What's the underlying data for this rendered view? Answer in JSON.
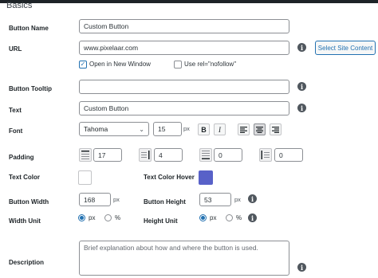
{
  "section": {
    "title": "Basics"
  },
  "labels": {
    "button_name": "Button Name",
    "url": "URL",
    "tooltip": "Button Tooltip",
    "text": "Text",
    "font": "Font",
    "padding": "Padding",
    "text_color": "Text Color",
    "text_color_hover": "Text Color Hover",
    "button_width": "Button Width",
    "button_height": "Button Height",
    "width_unit": "Width Unit",
    "height_unit": "Height Unit",
    "description": "Description"
  },
  "fields": {
    "button_name": "Custom Button",
    "url": "www.pixelaar.com",
    "tooltip": "",
    "text": "Custom Button",
    "font_family": "Tahoma",
    "font_size": "15",
    "font_size_unit": "px",
    "padding_top": "17",
    "padding_right": "4",
    "padding_bottom": "0",
    "padding_left": "0",
    "button_width": "168",
    "button_width_unit": "px",
    "button_height": "53",
    "button_height_unit": "px",
    "description_placeholder": "Brief explanation about how and where the button is used."
  },
  "checkboxes": {
    "open_new_window": {
      "label": "Open in New Window",
      "checked": true
    },
    "nofollow": {
      "label": "Use rel=\"nofollow\"",
      "checked": false
    }
  },
  "buttons": {
    "select_site_content": "Select Site Content"
  },
  "format": {
    "bold": "B",
    "italic": "I"
  },
  "colors": {
    "text_color": "#ffffff",
    "text_color_hover": "#5861c8",
    "accent": "#2271b1"
  },
  "units": {
    "px": "px",
    "percent": "%"
  },
  "width_unit_selected": "px",
  "height_unit_selected": "px",
  "icons": {
    "info": "info-icon",
    "chevron": "chevron-down-icon",
    "align_left": "align-left-icon",
    "align_center": "align-center-icon",
    "align_right": "align-right-icon",
    "check": "check-icon"
  }
}
